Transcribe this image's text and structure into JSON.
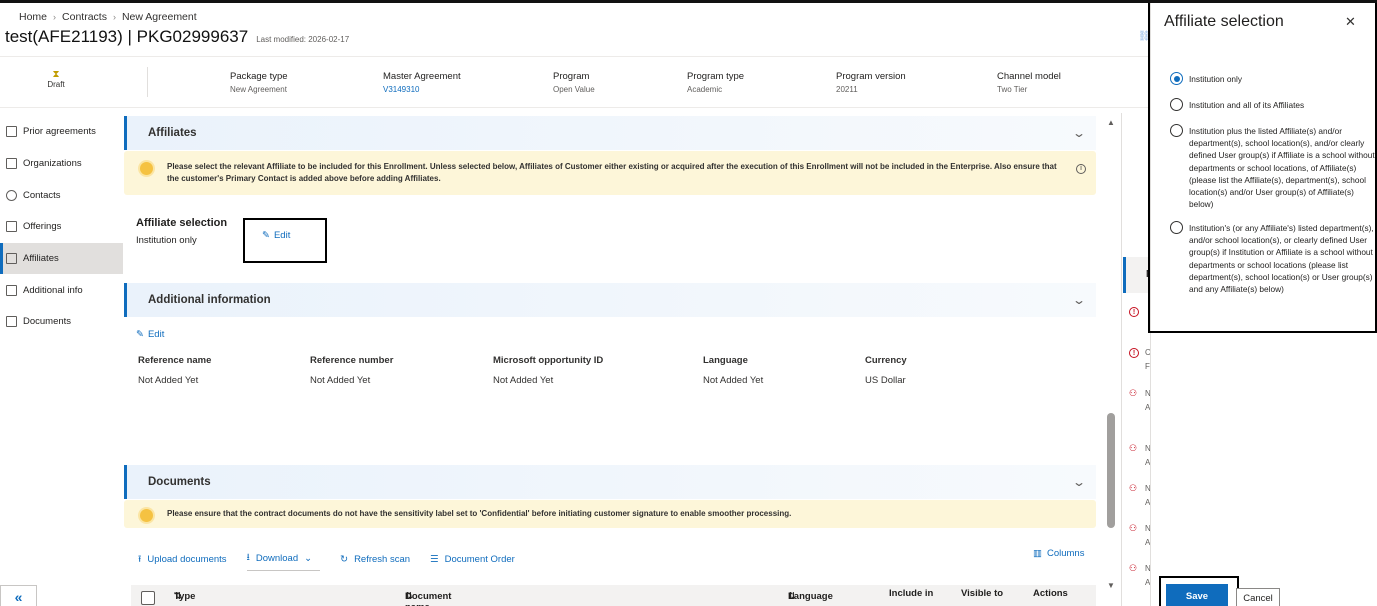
{
  "breadcrumb": [
    "Home",
    "Contracts",
    "New Agreement"
  ],
  "header": {
    "title": "test(AFE21193) | PKG02999637",
    "last_modified": "Last modified: 2026-02-17",
    "status": "Draft"
  },
  "meta": [
    {
      "label": "Package type",
      "value": "New Agreement"
    },
    {
      "label": "Master Agreement",
      "value": "V3149310"
    },
    {
      "label": "Program",
      "value": "Open Value"
    },
    {
      "label": "Program type",
      "value": "Academic"
    },
    {
      "label": "Program version",
      "value": "20211"
    },
    {
      "label": "Channel model",
      "value": "Two Tier"
    }
  ],
  "nav": [
    "Prior agreements",
    "Organizations",
    "Contacts",
    "Offerings",
    "Affiliates",
    "Additional info",
    "Documents"
  ],
  "affiliates": {
    "heading": "Affiliates",
    "banner": "Please select the relevant Affiliate to be included for this Enrollment. Unless selected below, Affiliates of Customer either existing or acquired after the execution of this Enrollment will not be included in the Enterprise. Also ensure that the customer's Primary Contact is added above before adding Affiliates.",
    "selection_label": "Affiliate selection",
    "selection_value": "Institution only",
    "edit": "Edit"
  },
  "additional_info": {
    "heading": "Additional information",
    "edit": "Edit",
    "columns": [
      {
        "label": "Reference name",
        "value": "Not Added Yet"
      },
      {
        "label": "Reference number",
        "value": "Not Added Yet"
      },
      {
        "label": "Microsoft opportunity ID",
        "value": "Not Added Yet"
      },
      {
        "label": "Language",
        "value": "Not Added Yet"
      },
      {
        "label": "Currency",
        "value": "US Dollar"
      }
    ]
  },
  "documents": {
    "heading": "Documents",
    "banner": "Please ensure that the contract documents do not have the sensitivity label set to 'Confidential' before initiating customer signature to enable smoother processing.",
    "toolbar": {
      "upload": "Upload documents",
      "download": "Download",
      "refresh": "Refresh scan",
      "order": "Document Order",
      "columns": "Columns"
    },
    "table_headers": [
      "Type",
      "Document name",
      "Language",
      "Include in",
      "Visible to",
      "Actions"
    ]
  },
  "right_panel": {
    "tab_letter": "N",
    "letters": [
      "C",
      "F",
      "N",
      "A",
      "N",
      "A",
      "N",
      "A",
      "N",
      "A",
      "N",
      "A"
    ]
  },
  "flyout": {
    "title": "Affiliate selection",
    "options": [
      {
        "label": "Institution only",
        "selected": true
      },
      {
        "label": "Institution and all of its Affiliates",
        "selected": false
      },
      {
        "label": "Institution plus the listed Affiliate(s) and/or department(s), school location(s), and/or clearly defined User group(s) if Affiliate is a school without departments or school locations, of Affiliate(s) (please list the Affiliate(s), department(s), school location(s) and/or User group(s) of Affiliate(s) below)",
        "selected": false
      },
      {
        "label": "Institution's (or any Affiliate's) listed department(s), and/or school location(s), or clearly defined User group(s) if Institution or Affiliate is a school without departments or school locations (please list department(s), school location(s) or User group(s) and any Affiliate(s) below)",
        "selected": false
      }
    ],
    "save": "Save",
    "cancel": "Cancel"
  },
  "colors": {
    "accent": "#0f6cbd",
    "banner": "#fdf6d9",
    "error": "#c50f1f"
  }
}
